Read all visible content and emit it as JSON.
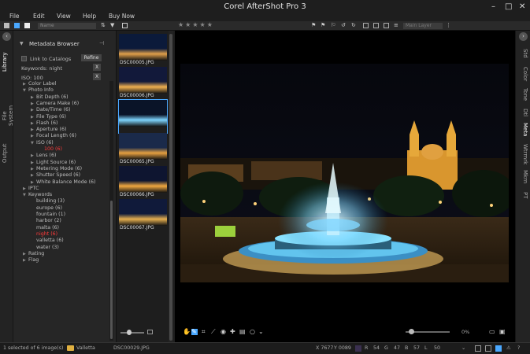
{
  "app": {
    "title": "Corel AfterShot Pro 3",
    "menu": [
      "File",
      "Edit",
      "View",
      "Help",
      "Buy Now"
    ]
  },
  "toolbar": {
    "sort_value": "Name",
    "layer_value": "Main Layer"
  },
  "left_tabs": [
    "Library",
    "File System",
    "Output"
  ],
  "panel": {
    "title": "Metadata Browser",
    "link_label": "Link to Catalogs",
    "refine_label": "Refine",
    "keyword_filter": "Keywords: night",
    "iso_filter": "ISO: 100",
    "clear_label": "X"
  },
  "tree": [
    {
      "label": "Color Label",
      "indent": 0,
      "arrow": "closed"
    },
    {
      "label": "Photo Info",
      "indent": 0,
      "arrow": "open"
    },
    {
      "label": "Bit Depth (6)",
      "indent": 1,
      "arrow": "closed"
    },
    {
      "label": "Camera Make (6)",
      "indent": 1,
      "arrow": "closed"
    },
    {
      "label": "Date/Time (6)",
      "indent": 1,
      "arrow": "closed"
    },
    {
      "label": "File Type (6)",
      "indent": 1,
      "arrow": "closed"
    },
    {
      "label": "Flash (6)",
      "indent": 1,
      "arrow": "closed"
    },
    {
      "label": "Aperture (6)",
      "indent": 1,
      "arrow": "closed"
    },
    {
      "label": "Focal Length (6)",
      "indent": 1,
      "arrow": "closed"
    },
    {
      "label": "ISO (6)",
      "indent": 1,
      "arrow": "open"
    },
    {
      "label": "100 (6)",
      "indent": 2,
      "arrow": "none",
      "highlight": true
    },
    {
      "label": "Lens (6)",
      "indent": 1,
      "arrow": "closed"
    },
    {
      "label": "Light Source (6)",
      "indent": 1,
      "arrow": "closed"
    },
    {
      "label": "Metering Mode (6)",
      "indent": 1,
      "arrow": "closed"
    },
    {
      "label": "Shutter Speed (6)",
      "indent": 1,
      "arrow": "closed"
    },
    {
      "label": "White Balance Mode (6)",
      "indent": 1,
      "arrow": "closed"
    },
    {
      "label": "IPTC",
      "indent": 0,
      "arrow": "closed"
    },
    {
      "label": "Keywords",
      "indent": 0,
      "arrow": "open"
    },
    {
      "label": "building (3)",
      "indent": 1,
      "arrow": "none"
    },
    {
      "label": "europe (6)",
      "indent": 1,
      "arrow": "none"
    },
    {
      "label": "fountain (1)",
      "indent": 1,
      "arrow": "none"
    },
    {
      "label": "harbor (2)",
      "indent": 1,
      "arrow": "none"
    },
    {
      "label": "malta (6)",
      "indent": 1,
      "arrow": "none"
    },
    {
      "label": "night (6)",
      "indent": 1,
      "arrow": "none",
      "highlight": true
    },
    {
      "label": "valletta (6)",
      "indent": 1,
      "arrow": "none"
    },
    {
      "label": "water (3)",
      "indent": 1,
      "arrow": "none"
    },
    {
      "label": "Rating",
      "indent": 0,
      "arrow": "closed"
    },
    {
      "label": "Flag",
      "indent": 0,
      "arrow": "closed"
    }
  ],
  "thumbnails": [
    {
      "label": "DSC00005.JPG",
      "selected": false
    },
    {
      "label": "DSC00006.JPG",
      "selected": false
    },
    {
      "label": "",
      "selected": true
    },
    {
      "label": "DSC00065.JPG",
      "selected": false
    },
    {
      "label": "DSC00066.JPG",
      "selected": false
    },
    {
      "label": "DSC00067.JPG",
      "selected": false
    }
  ],
  "viewer": {
    "zoom": "0%"
  },
  "right_tabs": [
    "Std",
    "Color",
    "Tone",
    "Dtl",
    "Meta",
    "Wtrmrk",
    "Mkrn",
    "PT"
  ],
  "status": {
    "selection": "1 selected of 6 image(s)",
    "folder": "Valletta",
    "filename": "DSC00029.JPG",
    "x_coord": "X 7677",
    "y_coord": "Y 0089",
    "r_label": "R",
    "r_value": "54",
    "g_label": "G",
    "g_value": "47",
    "b_label": "B",
    "b_value": "57",
    "l_label": "L",
    "l_value": "50"
  },
  "colors": {
    "accent": "#4aa8ff",
    "highlight_red": "#ff3b3b"
  }
}
